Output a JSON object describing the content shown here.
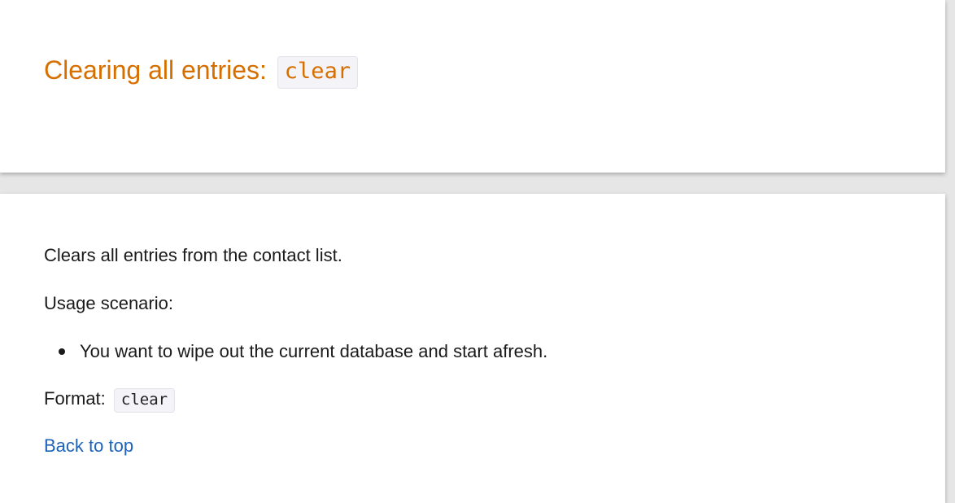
{
  "section": {
    "heading_text": "Clearing all entries:",
    "heading_code": "clear"
  },
  "content": {
    "description": "Clears all entries from the contact list.",
    "usage_label": "Usage scenario:",
    "usage_items": [
      "You want to wipe out the current database and start afresh."
    ],
    "format_label": "Format:",
    "format_code": "clear",
    "back_link": "Back to top"
  },
  "colors": {
    "heading": "#d76f00",
    "link": "#1d63b8",
    "code_bg": "#f3f3f8",
    "page_bg": "#e6e6e6"
  }
}
